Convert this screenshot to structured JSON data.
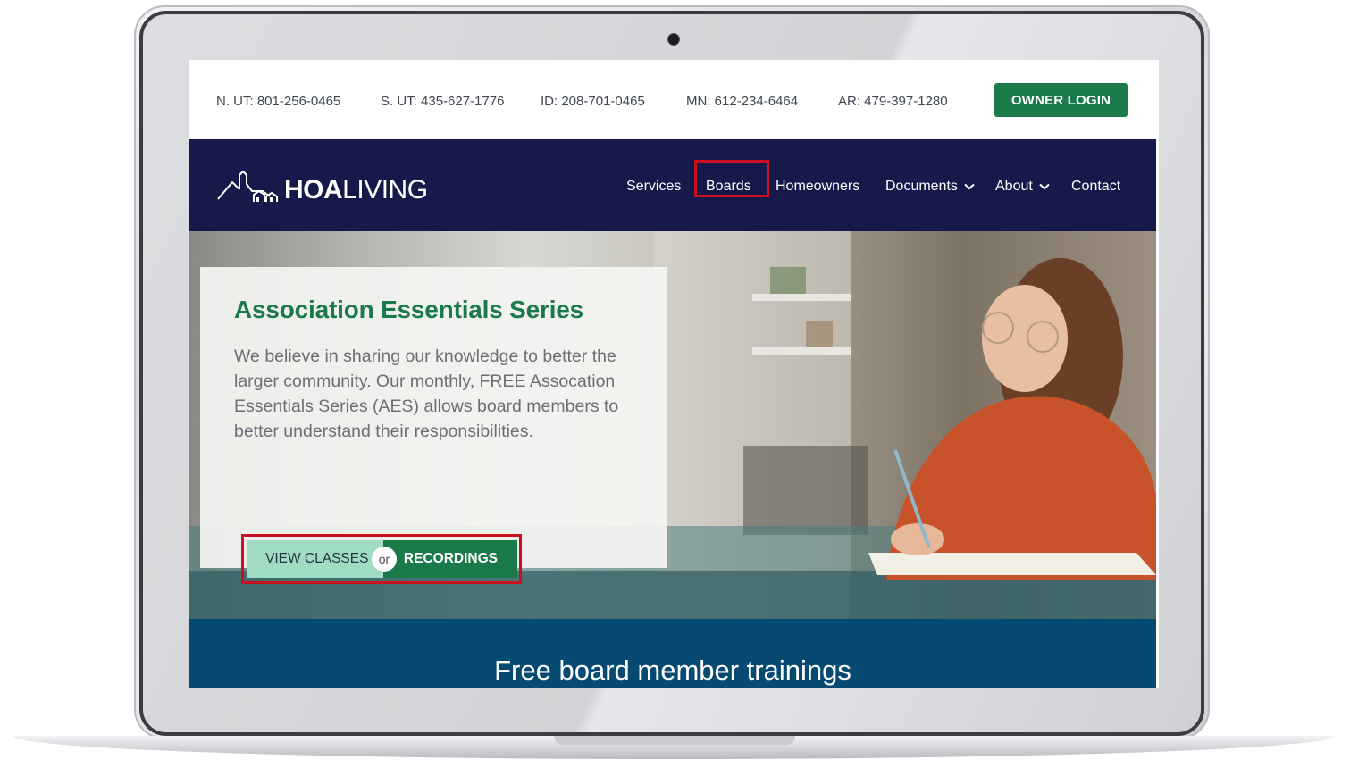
{
  "site": {
    "phones": [
      {
        "label": "N. UT: 801-256-0465"
      },
      {
        "label": "S. UT: 435-627-1776"
      },
      {
        "label": "ID: 208-701-0465"
      },
      {
        "label": "MN: 612-234-6464"
      },
      {
        "label": "AR: 479-397-1280"
      }
    ],
    "owner_login": "OWNER LOGIN",
    "logo": {
      "bold": "HOA",
      "light": "LIVING"
    },
    "nav": {
      "services": "Services",
      "boards": "Boards",
      "homeowners": "Homeowners",
      "documents": "Documents",
      "about": "About",
      "contact": "Contact"
    }
  },
  "hero": {
    "title": "Association Essentials Series",
    "text": "We believe in sharing our knowledge to better the larger community. Our monthly, FREE Assocation Essentials Series (AES) allows board members to better understand their responsibilities.",
    "cta_classes": "VIEW CLASSES",
    "cta_or": "or",
    "cta_recordings": "RECORDINGS"
  },
  "section": {
    "title": "Free board member trainings"
  },
  "colors": {
    "brand_green": "#1b7a49",
    "nav_navy": "#161a4a",
    "section_blue": "#064a72",
    "highlight_red": "#c8101e",
    "light_green": "#9fdcc2"
  }
}
